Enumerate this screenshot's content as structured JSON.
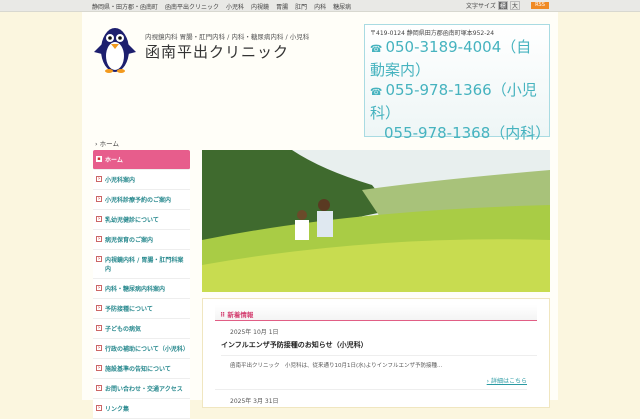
{
  "topbar": {
    "nav": [
      "静岡県・田方郡・函南町",
      "函南平出クリニック",
      "小児科",
      "内視鏡",
      "胃腸",
      "肛門",
      "内科",
      "糖尿病"
    ],
    "fontsize_label": "文字サイズ",
    "fontsize_options": [
      "標",
      "大"
    ],
    "rss": "RSS"
  },
  "header": {
    "subtitle": "内視鏡内科 胃腸・肛門内科 / 内科・糖尿病内科 / 小児科",
    "title": "函南平出クリニック",
    "logo_alt": "penguin logo"
  },
  "contact": {
    "address": "〒419-0124 静岡県田方郡函南町塚本952-24",
    "phones": [
      "050-3189-4004（自動案内）",
      "055-978-1366（小児科）",
      "055-978-1368（内科）"
    ]
  },
  "breadcrumb": "ホーム",
  "sidebar": {
    "items": [
      "ホーム",
      "小児科案内",
      "小児科診療予約のご案内",
      "乳幼児健診について",
      "病児保育のご案内",
      "内視鏡内科 / 胃腸・肛門科案内",
      "内科・糖尿病内科案内",
      "予防接種について",
      "子どもの病気",
      "行政の補助について（小児科）",
      "施設基準の告知について",
      "お問い合わせ・交通アクセス",
      "リンク集"
    ]
  },
  "news": {
    "heading": "新着情報",
    "items": [
      {
        "date": "2025年 10月 1日",
        "title": "インフルエンザ予防接種のお知らせ（小児科）",
        "body": "函南平出クリニック　小児科は、従来通り10月1日(水)よりインフルエンザ予防接種...",
        "more": "詳細はこちら"
      },
      {
        "date": "2025年 3月 31日"
      }
    ]
  }
}
